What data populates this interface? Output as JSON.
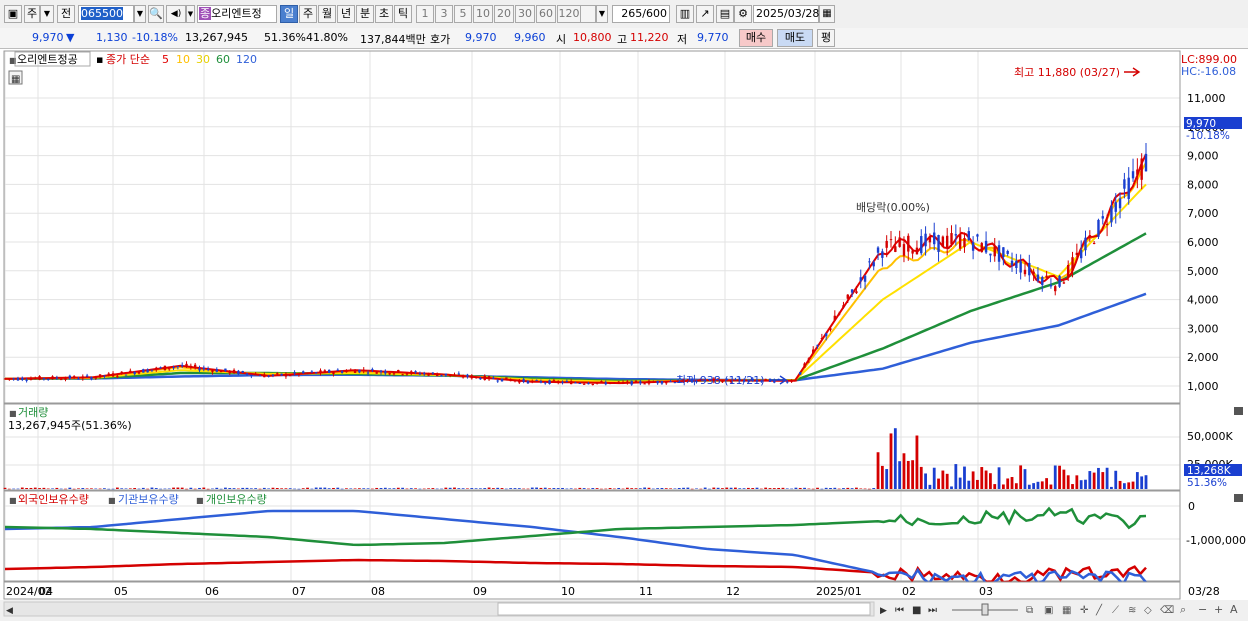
{
  "toolbar": {
    "market": "주",
    "prev_label": "전",
    "code": "065500",
    "stock_name": "오리엔트정",
    "periods": [
      "일",
      "주",
      "월",
      "년",
      "분",
      "초",
      "틱"
    ],
    "intervals": [
      "1",
      "3",
      "5",
      "10",
      "20",
      "30",
      "60",
      "120"
    ],
    "count": "265",
    "count_total": "/600",
    "date": "2025/03/28"
  },
  "quote": {
    "price": "9,970",
    "down_arrow": "▼",
    "change": "1,130",
    "change_pct": "-10.18%",
    "volume": "13,267,945",
    "vol_ratio": "51.36%",
    "turnover": "41.80%",
    "amount": "137,844백만",
    "ask_label": "호가",
    "ask": "9,970",
    "bid": "9,960",
    "open_label": "시",
    "open": "10,800",
    "high_label": "고",
    "high": "11,220",
    "low_label": "저",
    "low": "9,770",
    "buy_button": "매수",
    "sell_button": "매도",
    "eval_button": "평"
  },
  "price_panel": {
    "stock_name": "오리엔트정공",
    "ma_label": "종가 단순",
    "ma_periods": [
      {
        "label": "5",
        "color": "#e00000"
      },
      {
        "label": "10",
        "color": "#ffc000"
      },
      {
        "label": "30",
        "color": "#ffe000"
      },
      {
        "label": "60",
        "color": "#1f8f3a"
      },
      {
        "label": "120",
        "color": "#2f5fd8"
      }
    ],
    "lc": "LC:899.00",
    "hc": "HC:-16.08",
    "current_price_tag": "9,970",
    "current_pct_tag": "-10.18%",
    "high_annotation": "최고 11,880 (03/27)",
    "low_annotation": "최저 938 (11/21)",
    "dividend_annotation": "배당락(0.00%)"
  },
  "volume_panel": {
    "title": "거래량",
    "info": "13,267,945주(51.36%)",
    "tag": "13,268K",
    "tag_pct": "51.36%"
  },
  "holding_panel": {
    "legend": [
      {
        "label": "외국인보유수량",
        "color": "#d40000"
      },
      {
        "label": "기관보유수량",
        "color": "#2f5fd8"
      },
      {
        "label": "개인보유수량",
        "color": "#1f8f3a"
      }
    ]
  },
  "x_axis_labels": [
    "2024/02",
    "04",
    "05",
    "06",
    "07",
    "08",
    "09",
    "10",
    "11",
    "12",
    "2025/01",
    "02",
    "03"
  ],
  "x_axis_right": "03/28",
  "chart_data": [
    {
      "type": "line",
      "title": "",
      "y_ticks": [
        1000,
        2000,
        3000,
        4000,
        5000,
        6000,
        7000,
        8000,
        9000,
        10000,
        11000
      ],
      "y_tick_labels": [
        "1,000",
        "2,000",
        "3,000",
        "4,000",
        "5,000",
        "6,000",
        "7,000",
        "8,000",
        "9,000",
        "10,000",
        "11,000"
      ],
      "ylim": [
        0,
        12000
      ],
      "months": [
        "2024-02",
        "2024-03",
        "2024-04",
        "2024-05",
        "2024-06",
        "2024-07",
        "2024-08",
        "2024-09",
        "2024-10",
        "2024-11",
        "2024-12",
        "2025-01",
        "2025-02",
        "2025-03"
      ],
      "series": [
        {
          "name": "5",
          "values": [
            1250,
            1300,
            1700,
            1350,
            1550,
            1400,
            1150,
            1100,
            1200,
            1180,
            5800,
            6100,
            4500,
            8800
          ]
        },
        {
          "name": "10",
          "values": [
            1250,
            1300,
            1650,
            1380,
            1500,
            1400,
            1180,
            1120,
            1200,
            1190,
            5200,
            6000,
            4600,
            8600
          ]
        },
        {
          "name": "30",
          "values": [
            1250,
            1280,
            1550,
            1420,
            1450,
            1380,
            1220,
            1150,
            1190,
            1200,
            4000,
            6000,
            4800,
            8000
          ]
        },
        {
          "name": "60",
          "values": [
            1250,
            1270,
            1450,
            1450,
            1420,
            1370,
            1260,
            1180,
            1190,
            1200,
            2300,
            3600,
            4600,
            6300
          ]
        },
        {
          "name": "120",
          "values": [
            1250,
            1260,
            1330,
            1380,
            1390,
            1360,
            1300,
            1240,
            1210,
            1200,
            1600,
            2500,
            3100,
            4200
          ]
        }
      ],
      "high": 11880,
      "low": 938
    },
    {
      "type": "bar",
      "title": "",
      "y_tick_labels": [
        "50,000K",
        "25,000K"
      ],
      "ylim": [
        0,
        60000
      ],
      "last_value_k": 13268
    },
    {
      "type": "line",
      "title": "",
      "y_tick_labels": [
        "0",
        "-1,000,000"
      ],
      "series": [
        {
          "name": "외국인보유수량"
        },
        {
          "name": "기관보유수량"
        },
        {
          "name": "개인보유수량"
        }
      ]
    }
  ]
}
